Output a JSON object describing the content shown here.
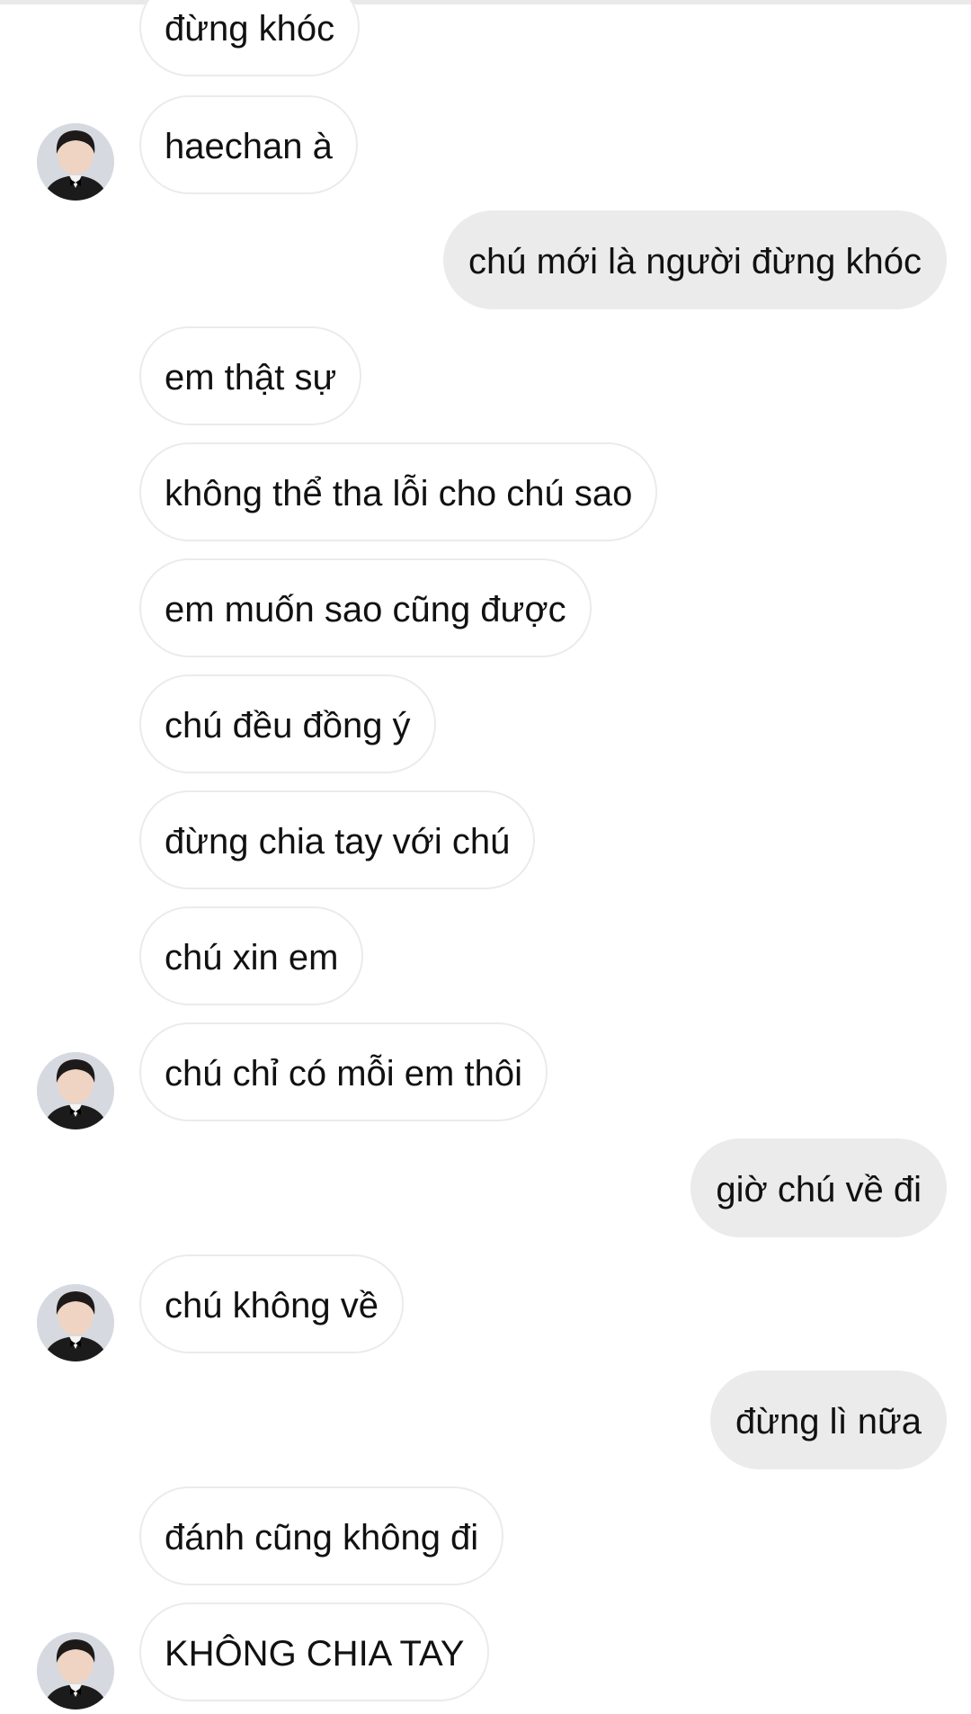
{
  "chat": {
    "messages": [
      {
        "side": "in",
        "text": "đừng khóc"
      },
      {
        "side": "in",
        "text": "haechan à"
      },
      {
        "side": "out",
        "text": "chú mới là người đừng khóc"
      },
      {
        "side": "in",
        "text": "em thật sự"
      },
      {
        "side": "in",
        "text": "không thể tha lỗi cho chú sao"
      },
      {
        "side": "in",
        "text": "em muốn sao cũng được"
      },
      {
        "side": "in",
        "text": "chú đều đồng ý"
      },
      {
        "side": "in",
        "text": "đừng chia tay với chú"
      },
      {
        "side": "in",
        "text": "chú xin em"
      },
      {
        "side": "in",
        "text": "chú chỉ có mỗi em thôi"
      },
      {
        "side": "out",
        "text": "giờ chú về đi"
      },
      {
        "side": "in",
        "text": "chú không về"
      },
      {
        "side": "out",
        "text": "đừng lì nữa"
      },
      {
        "side": "in",
        "text": "đánh cũng không đi"
      },
      {
        "side": "in",
        "text": "KHÔNG CHIA TAY"
      }
    ]
  },
  "colors": {
    "incoming_bubble": "#ffffff",
    "incoming_border": "#ebebeb",
    "outgoing_bubble": "#ebebeb",
    "text": "#111111"
  },
  "icons": {
    "avatar": "contact-avatar-icon"
  }
}
